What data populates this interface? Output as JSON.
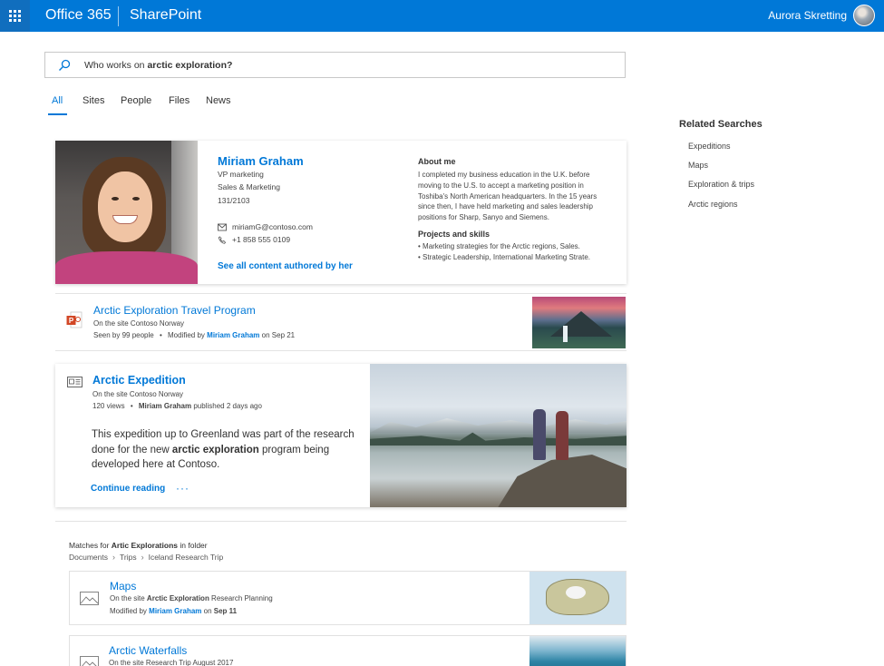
{
  "header": {
    "brand": "Office 365",
    "app": "SharePoint",
    "user_name": "Aurora Skretting"
  },
  "search": {
    "query_prefix": "Who works on ",
    "query_bold": "arctic exploration?"
  },
  "tabs": [
    {
      "label": "All",
      "active": true
    },
    {
      "label": "Sites",
      "active": false
    },
    {
      "label": "People",
      "active": false
    },
    {
      "label": "Files",
      "active": false
    },
    {
      "label": "News",
      "active": false
    }
  ],
  "related": {
    "title": "Related Searches",
    "items": [
      "Expeditions",
      "Maps",
      "Exploration & trips",
      "Arctic regions"
    ]
  },
  "person": {
    "name": "Miriam Graham",
    "title": "VP marketing",
    "department": "Sales & Marketing",
    "office": "131/2103",
    "email": "miriamG@contoso.com",
    "phone": "+1 858 555 0109",
    "see_all": "See all content authored by her",
    "about_title": "About me",
    "about_text": "I completed my business education in the U.K. before moving to the U.S. to accept a marketing position in Toshiba's North American headquarters. In the 15 years since then, I have held marketing and sales leadership positions for Sharp, Sanyo and Siemens.",
    "skills_title": "Projects and skills",
    "skills": [
      "• Marketing strategies for the Arctic regions, Sales.",
      "• Strategic Leadership, International Marketing Strate."
    ]
  },
  "result1": {
    "title": "Arctic Exploration Travel Program",
    "site": "On the site Contoso Norway",
    "seen": "Seen by 99 people",
    "bullet": "•",
    "modified_by_label": "Modified by",
    "modified_by": "Miriam Graham",
    "modified_on": "on Sep 21"
  },
  "article": {
    "title": "Arctic Expedition",
    "site": "On the site Contoso Norway",
    "views": "120 views",
    "bullet": "•",
    "author": "Miriam Graham",
    "published": "published 2 days ago",
    "body_1": "This expedition up to Greenland was part of the research done for the new ",
    "body_bold": "arctic exploration",
    "body_2": " program being developed here at Contoso.",
    "continue": "Continue reading",
    "more": "···"
  },
  "folder": {
    "label_prefix": "Matches for ",
    "label_bold": "Artic Explorations",
    "label_suffix": " in folder",
    "crumbs": [
      "Documents",
      "Trips",
      "Iceland Research Trip"
    ]
  },
  "files": [
    {
      "title": "Maps",
      "site_prefix": "On the site ",
      "site_bold": "Arctic Exploration",
      "site_suffix": " Research Planning",
      "modified_by_label": "Modified by",
      "modified_by": "Miriam Graham",
      "modified_on_prefix": "on ",
      "modified_on": "Sep 11"
    },
    {
      "title": "Arctic Waterfalls",
      "site": "On the site Research Trip August 2017"
    }
  ],
  "colors": {
    "accent": "#0078d7",
    "topbar": "#0078d7",
    "waffle_bg": "#106ebe"
  }
}
